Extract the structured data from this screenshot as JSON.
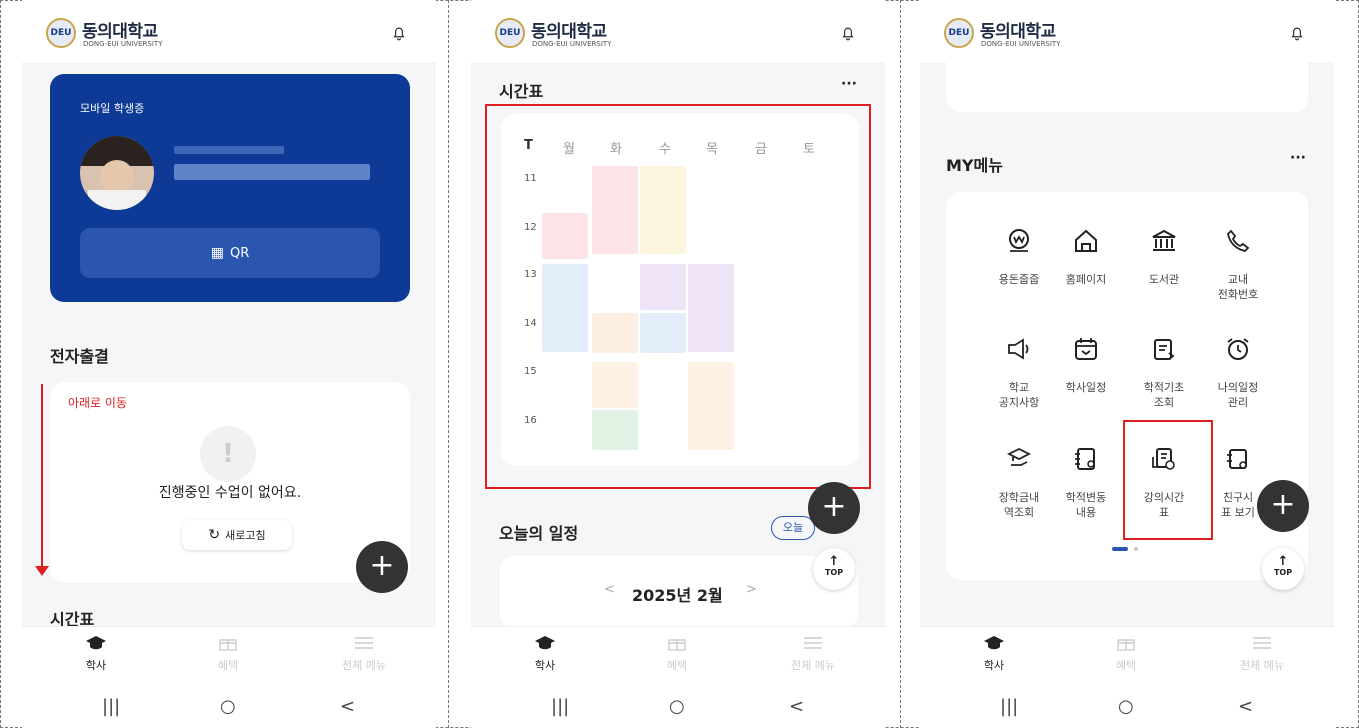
{
  "app": {
    "logo_kr": "동의대학교",
    "logo_en": "DONG-EUI UNIVERSITY",
    "logo_badge": "DEU"
  },
  "panel1": {
    "card_title": "모바일 학생증",
    "qr_label": "QR",
    "attendance_title": "전자출결",
    "move_label": "아래로 이동",
    "no_class": "진행중인 수업이 없어요.",
    "refresh": "새로고침",
    "next_section": "시간표"
  },
  "panel2": {
    "timetable_title": "시간표",
    "days": [
      "T",
      "월",
      "화",
      "수",
      "목",
      "금",
      "토"
    ],
    "hours": [
      "11",
      "12",
      "13",
      "14",
      "15",
      "16"
    ],
    "schedule_title": "오늘의 일정",
    "today_badge": "오늘",
    "month": "2025년 2월",
    "prev": "<",
    "next": ">",
    "more": "···"
  },
  "panel3": {
    "menu_title": "MY메뉴",
    "more": "···",
    "items": [
      {
        "label": "용돈줍줍",
        "label2": ""
      },
      {
        "label": "홈페이지",
        "label2": ""
      },
      {
        "label": "도서관",
        "label2": ""
      },
      {
        "label": "교내",
        "label2": "전화번호"
      },
      {
        "label": "학교",
        "label2": "공지사항"
      },
      {
        "label": "학사일정",
        "label2": ""
      },
      {
        "label": "학적기초",
        "label2": "조회"
      },
      {
        "label": "나의일정",
        "label2": "관리"
      },
      {
        "label": "장학금내",
        "label2": "역조회"
      },
      {
        "label": "학적변동",
        "label2": "내용"
      },
      {
        "label": "강의시간",
        "label2": "표"
      },
      {
        "label": "친구시",
        "label2": "표 보기"
      }
    ]
  },
  "nav": {
    "academic": "학사",
    "benefit": "혜택",
    "all_menu": "전체 메뉴"
  },
  "fab": "+",
  "top": "TOP",
  "sys": {
    "recent": "|||",
    "home": "○",
    "back": "<"
  },
  "colors": {
    "brand": "#0c3a96",
    "highlight": "#e02020"
  }
}
